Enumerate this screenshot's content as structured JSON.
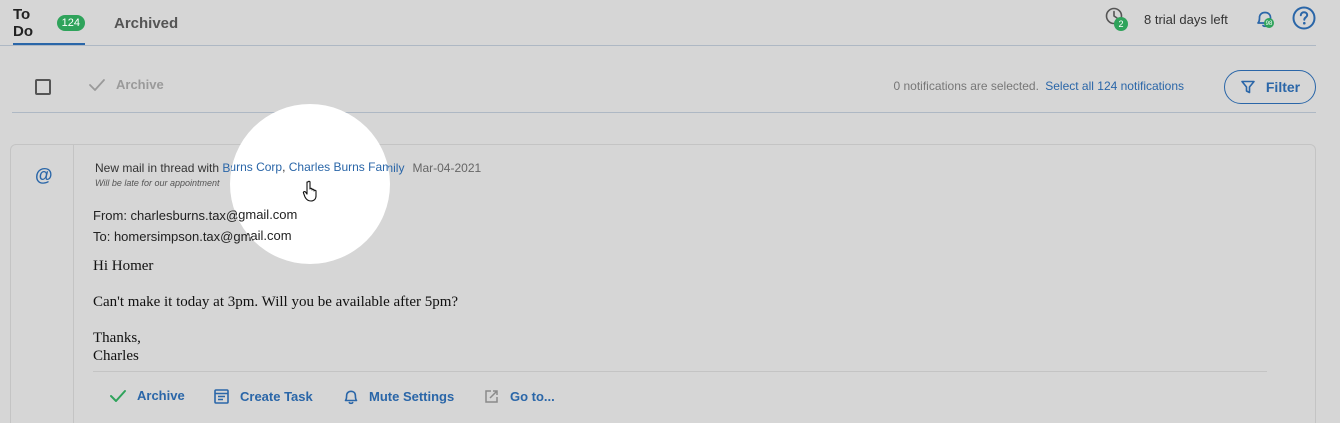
{
  "tabs": [
    {
      "label": "To Do",
      "badge": "124"
    },
    {
      "label": "Archived"
    }
  ],
  "header": {
    "history_badge": "2",
    "trial_text": "8 trial days left",
    "bell_badge": "98"
  },
  "toolbar": {
    "archive_label": "Archive",
    "selected_text": "0 notifications are selected.",
    "select_all_link": "Select all 124 notifications",
    "filter_label": "Filter"
  },
  "notification": {
    "prefix": "New mail in thread with ",
    "link1": "Burns Corp",
    "separator": ", ",
    "link2": "Charles Burns Family",
    "date": "Mar-04-2021",
    "subject": "Will be late for our appointment",
    "from": "From: charlesburns.tax@gmail.com",
    "to": "To: homersimpson.tax@gmail.com",
    "greeting": "Hi Homer",
    "message": "Can't make it today at 3pm. Will you be available after 5pm?",
    "closing": "Thanks,",
    "signature": "Charles"
  },
  "actions": {
    "archive": "Archive",
    "create_task": "Create Task",
    "mute_settings": "Mute Settings",
    "goto": "Go to..."
  },
  "colors": {
    "accent": "#2a66a8",
    "badge": "#2fa35b",
    "background": "#d6d6d6"
  }
}
